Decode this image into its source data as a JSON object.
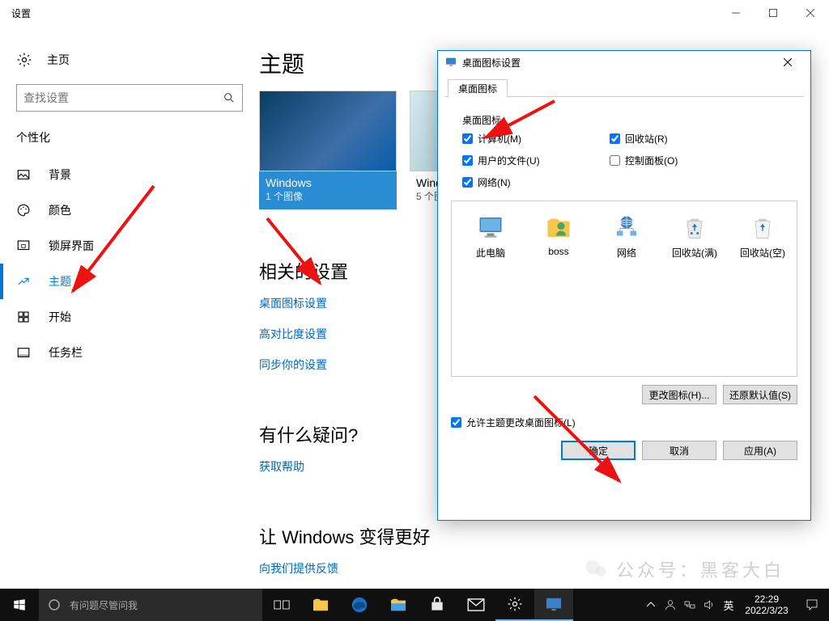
{
  "window": {
    "title": "设置"
  },
  "home_label": "主页",
  "search_placeholder": "查找设置",
  "section": "个性化",
  "nav": {
    "background": "背景",
    "colors": "颜色",
    "lockscreen": "锁屏界面",
    "themes": "主题",
    "start": "开始",
    "taskbar": "任务栏"
  },
  "main": {
    "title": "主题",
    "theme1": {
      "name": "Windows",
      "sub": "1 个图像"
    },
    "theme2": {
      "name": "Windows",
      "sub": "5 个图像"
    },
    "related_title": "相关的设置",
    "link_desktop_icons": "桌面图标设置",
    "link_high_contrast": "高对比度设置",
    "link_sync": "同步你的设置",
    "faq_title": "有什么疑问?",
    "link_help": "获取帮助",
    "better_title": "让 Windows 变得更好",
    "link_feedback": "向我们提供反馈"
  },
  "dialog": {
    "title": "桌面图标设置",
    "tab": "桌面图标",
    "group": "桌面图标",
    "chk_computer": "计算机(M)",
    "chk_recycle": "回收站(R)",
    "chk_userfiles": "用户的文件(U)",
    "chk_controlpanel": "控制面板(O)",
    "chk_network": "网络(N)",
    "icon_thispc": "此电脑",
    "icon_boss": "boss",
    "icon_network": "网络",
    "icon_recycle_full": "回收站(满)",
    "icon_recycle_empty": "回收站(空)",
    "btn_change": "更改图标(H)...",
    "btn_restore": "还原默认值(S)",
    "allow_theme": "允许主题更改桌面图标(L)",
    "btn_ok": "确定",
    "btn_cancel": "取消",
    "btn_apply": "应用(A)"
  },
  "taskbar": {
    "cortana_placeholder": "有问题尽管问我",
    "ime": "英",
    "time": "22:29",
    "date": "2022/3/23"
  },
  "watermark": "公众号：黑客大白"
}
